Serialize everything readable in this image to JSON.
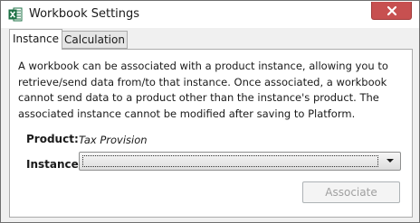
{
  "window": {
    "title": "Workbook Settings",
    "app_icon": "excel-icon",
    "close_icon": "close-icon"
  },
  "tabs": [
    {
      "label": "Instance",
      "selected": true
    },
    {
      "label": "Calculation",
      "selected": false
    }
  ],
  "instance_tab": {
    "description": "A workbook can be associated with a product instance, allowing you to retrieve/send data from/to that instance. Once associated, a workbook cannot send data to a product other than the instance's product. The associated instance cannot be modified after saving to Platform.",
    "product_label": "Product:",
    "product_value": "Tax Provision",
    "instance_label": "Instance:",
    "instance_selected": "",
    "associate_button": "Associate",
    "associate_enabled": false
  },
  "colors": {
    "close_button": "#c75050",
    "excel_green": "#1e7145",
    "disabled_text": "#a0a0a0"
  }
}
